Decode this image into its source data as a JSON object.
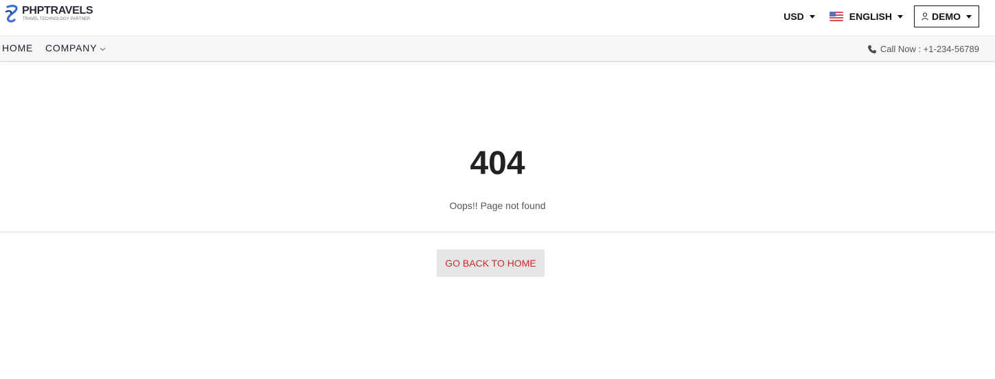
{
  "header": {
    "logo": {
      "name": "PHPTRAVELS",
      "tagline": "TRAVEL TECHNOLOGY PARTNER"
    },
    "currency": {
      "label": "USD"
    },
    "language": {
      "label": "ENGLISH",
      "flag": "us-flag-icon"
    },
    "account": {
      "label": "DEMO",
      "icon": "user-icon"
    }
  },
  "nav": {
    "items": [
      {
        "label": "HOME"
      },
      {
        "label": "COMPANY",
        "has_dropdown": true
      }
    ],
    "call": {
      "text": "Call Now : +1-234-56789",
      "icon": "phone-icon"
    }
  },
  "main": {
    "error_code": "404",
    "message": "Oops!! Page not found",
    "back_button": "GO BACK TO HOME"
  },
  "colors": {
    "accent_red": "#d3262b",
    "logo_blue": "#3a6fd8",
    "nav_bg": "#f5f6f7",
    "button_bg": "#e6e6e6"
  }
}
